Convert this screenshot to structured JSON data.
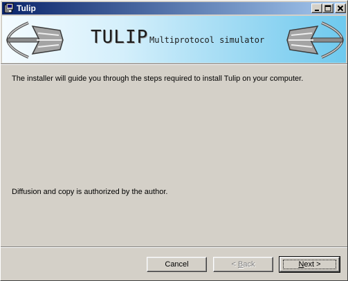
{
  "window": {
    "title": "Tulip"
  },
  "banner": {
    "title": "TULIP",
    "subtitle": "Multiprotocol simulator"
  },
  "content": {
    "intro": "The installer will guide you through the steps required to install Tulip on your computer.",
    "notice": "Diffusion and copy is authorized by the author."
  },
  "buttons": {
    "cancel": "Cancel",
    "back_prefix": "< ",
    "back_key": "B",
    "back_rest": "ack",
    "next_key": "N",
    "next_rest": "ext >"
  },
  "icons": {
    "app": "installer-icon",
    "minimize": "minimize-icon",
    "maximize": "maximize-icon",
    "close": "close-icon",
    "logo": "tulip-logo"
  },
  "colors": {
    "titlebar_start": "#0a246a",
    "titlebar_end": "#a6caf0",
    "banner_end": "#6ec9ee"
  }
}
